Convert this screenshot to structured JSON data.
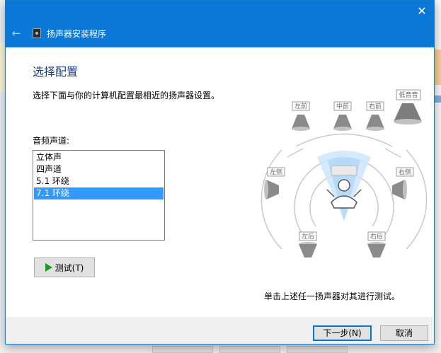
{
  "window": {
    "title": "扬声器安装程序",
    "close_glyph": "✕",
    "back_glyph": "←"
  },
  "page": {
    "title": "选择配置",
    "instruction": "选择下面与你的计算机配置最相近的扬声器设置。",
    "channels_label": "音频声道:"
  },
  "channels": {
    "items": [
      "立体声",
      "四声道",
      "5.1 环绕",
      "7.1 环绕"
    ],
    "selected": "7.1 环绕"
  },
  "test_button": {
    "label": "测试(T)"
  },
  "speakers": {
    "front_left": "左前",
    "center": "中前",
    "front_right": "右前",
    "subwoofer": "低音音",
    "side_left": "左侧",
    "side_right": "右侧",
    "rear_left": "左后",
    "rear_right": "右后"
  },
  "hint": "单击上述任一扬声器对其进行测试。",
  "footer": {
    "next_label": "下一步(N)",
    "cancel_label": "取消"
  },
  "colors": {
    "titlebar": "#0b78d7",
    "selection": "#3399ff",
    "page_title": "#1a3d7c",
    "play": "#1aa01a"
  }
}
